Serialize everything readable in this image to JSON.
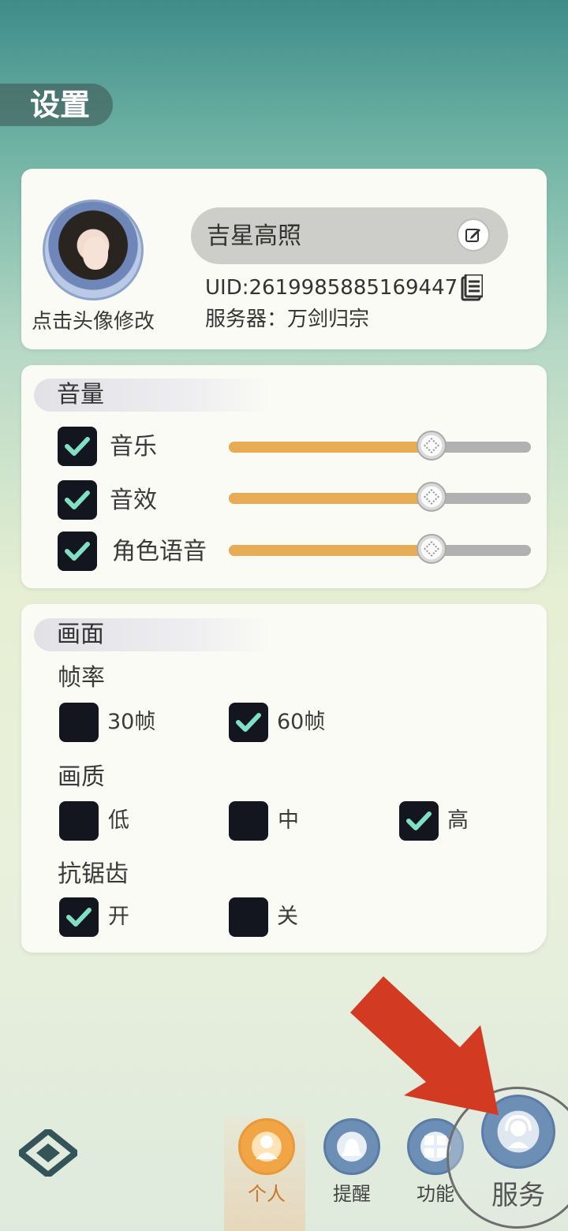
{
  "page": {
    "title": "设置"
  },
  "profile": {
    "avatar_caption": "点击头像修改",
    "name": "吉星高照",
    "uid": "UID:2619985885169447",
    "server": "服务器：万剑归宗"
  },
  "volume": {
    "heading": "音量",
    "items": [
      {
        "label": "音乐",
        "checked": true,
        "level": 0.67
      },
      {
        "label": "音效",
        "checked": true,
        "level": 0.67
      },
      {
        "label": "角色语音",
        "checked": true,
        "level": 0.67
      }
    ]
  },
  "display": {
    "heading": "画面",
    "framerate": {
      "label": "帧率",
      "options": [
        {
          "label": "30帧",
          "checked": false
        },
        {
          "label": "60帧",
          "checked": true
        }
      ]
    },
    "quality": {
      "label": "画质",
      "options": [
        {
          "label": "低",
          "checked": false
        },
        {
          "label": "中",
          "checked": false
        },
        {
          "label": "高",
          "checked": true
        }
      ]
    },
    "antialias": {
      "label": "抗锯齿",
      "options": [
        {
          "label": "开",
          "checked": true
        },
        {
          "label": "关",
          "checked": false
        }
      ]
    }
  },
  "nav": {
    "items": [
      {
        "label": "个人",
        "selected": true
      },
      {
        "label": "提醒",
        "selected": false
      },
      {
        "label": "功能",
        "selected": false
      },
      {
        "label": "服务",
        "selected": false
      }
    ]
  },
  "colors": {
    "accent": "#e8ac55",
    "check": "#7fe0c4",
    "checkbox_bg": "#13161e",
    "annotation_arrow": "#d23a22"
  }
}
